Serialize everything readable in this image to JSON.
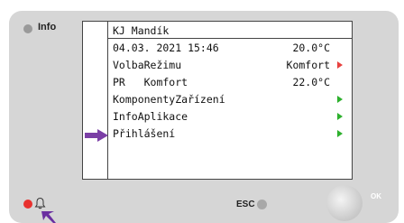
{
  "panel": {
    "info_label": "Info",
    "esc_label": "ESC",
    "ok_label": "OK"
  },
  "screen": {
    "title": "KJ Mandík",
    "date_time": "04.03. 2021 15:46",
    "temperature": "20.0°C",
    "rows": [
      {
        "label": "VolbaRežimu",
        "value": "Komfort",
        "arrow": "red"
      },
      {
        "label": "PR   Komfort",
        "value": "22.0°C",
        "arrow": ""
      },
      {
        "label": "KomponentyZařízení",
        "value": "",
        "arrow": "green"
      },
      {
        "label": "InfoAplikace",
        "value": "",
        "arrow": "green"
      },
      {
        "label": "Přihlášení",
        "value": "",
        "arrow": "green"
      }
    ]
  },
  "colors": {
    "pointer": "#7b3fa6",
    "arrow_green": "#2db02d",
    "arrow_red": "#e8413f",
    "alarm_led": "#e8312e"
  }
}
